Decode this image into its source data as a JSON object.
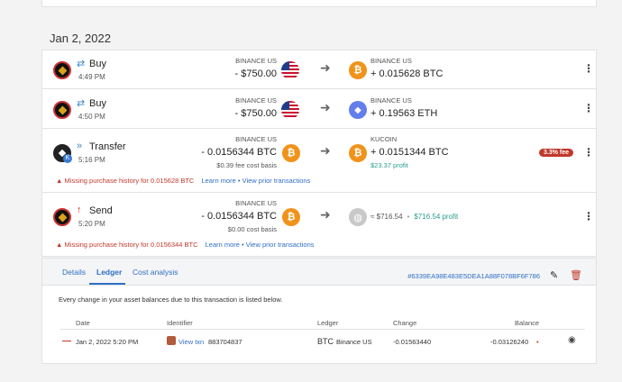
{
  "date_heading": "Jan 2, 2022",
  "transactions": [
    {
      "type": "Buy",
      "time": "4:49 PM",
      "src_exchange": "BINANCE US",
      "src_amount": "- $750.00",
      "dst_exchange": "BINANCE US",
      "dst_amount": "+ 0.015628 BTC"
    },
    {
      "type": "Buy",
      "time": "4:50 PM",
      "src_exchange": "BINANCE US",
      "src_amount": "- $750.00",
      "dst_exchange": "BINANCE US",
      "dst_amount": "+ 0.19563 ETH"
    },
    {
      "type": "Transfer",
      "time": "5:16 PM",
      "src_exchange": "BINANCE US",
      "src_amount": "- 0.0156344 BTC",
      "src_fee": "$0.39 fee cost basis",
      "dst_exchange": "KUCOIN",
      "dst_amount": "+ 0.0151344 BTC",
      "profit": "$23.37 profit",
      "fee_badge": "3.3% fee",
      "warning": "Missing purchase history for 0.015628 BTC",
      "warning_links": "Learn more • View prior transactions"
    },
    {
      "type": "Send",
      "time": "5:20 PM",
      "src_exchange": "BINANCE US",
      "src_amount": "- 0.0156344 BTC",
      "src_fee": "$0.00 cost basis",
      "dst_value": "≈ $716.54",
      "dst_profit": "$716.54 profit",
      "warning": "Missing purchase history for 0.0156344 BTC",
      "warning_links": "Learn more • View prior transactions"
    }
  ],
  "detail": {
    "tabs": [
      "Details",
      "Ledger",
      "Cost analysis"
    ],
    "hash": "#6339EA98E483E5DEA1A88F078BF6F786",
    "description": "Every change in your asset balances due to this transaction is listed below.",
    "columns": [
      "Date",
      "Identifier",
      "Ledger",
      "Change",
      "Balance"
    ],
    "row": {
      "date": "Jan 2, 2022 5:20 PM",
      "view_txn": "View txn",
      "identifier": "883704837",
      "asset": "BTC",
      "ledger": "Binance US",
      "change": "-0.01563440",
      "balance": "-0.03126240"
    }
  },
  "colors": {
    "accent": "#2f6fc4",
    "error": "#c0392b",
    "profit": "#2a9d8f",
    "btc": "#f0931a",
    "eth": "#627eea"
  },
  "icons": [
    "transfer-arrows-icon",
    "chevrons-right-icon",
    "arrow-up-icon",
    "us-flag-icon",
    "bitcoin-icon",
    "ethereum-icon",
    "globe-icon",
    "arrow-right-icon",
    "kebab-menu-icon",
    "warning-icon",
    "pencil-icon",
    "trash-icon",
    "eye-icon"
  ]
}
